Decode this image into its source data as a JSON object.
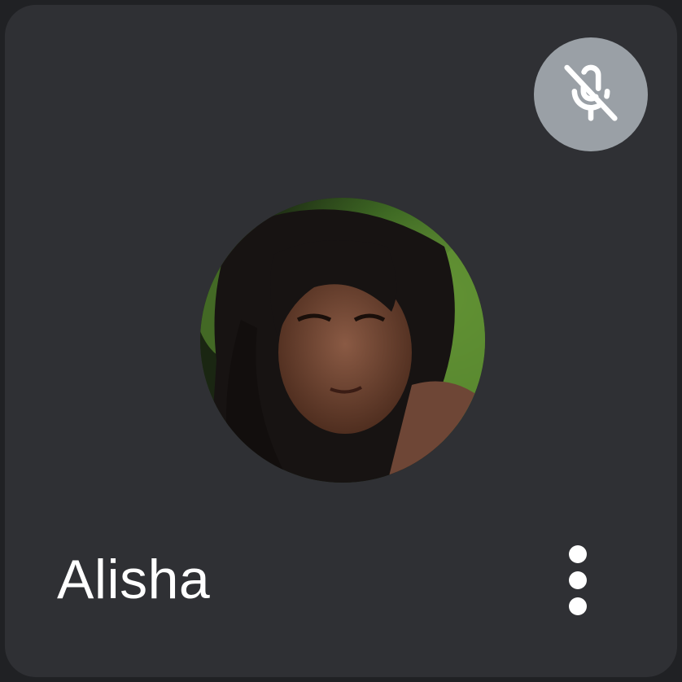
{
  "participant": {
    "name": "Alisha",
    "muted": true
  },
  "icons": {
    "mute_indicator": "mic-off-icon",
    "more_options": "more-vert-icon",
    "avatar": "participant-photo"
  },
  "colors": {
    "tile_background": "#2f3034",
    "page_background": "#202124",
    "mute_badge_background": "#9aa0a6",
    "text": "#ffffff"
  }
}
